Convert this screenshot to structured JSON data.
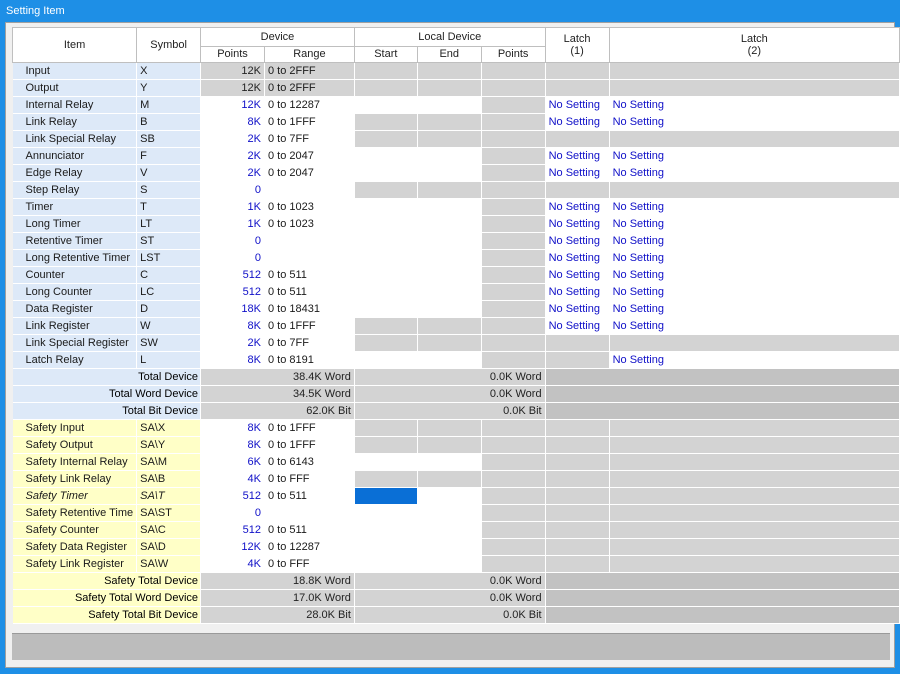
{
  "window": {
    "title": "Setting Item"
  },
  "headers": {
    "item": "Item",
    "symbol": "Symbol",
    "device": "Device",
    "local_device": "Local Device",
    "points": "Points",
    "range": "Range",
    "start": "Start",
    "end": "End",
    "local_points": "Points",
    "latch1": "Latch\n(1)",
    "latch2": "Latch\n(2)"
  },
  "devices": [
    {
      "name": "Input",
      "symbol": "X",
      "points": "12K",
      "range": "0 to 2FFF",
      "latch1": "",
      "latch2": ""
    },
    {
      "name": "Output",
      "symbol": "Y",
      "points": "12K",
      "range": "0 to 2FFF",
      "latch1": "",
      "latch2": ""
    },
    {
      "name": "Internal Relay",
      "symbol": "M",
      "points": "12K",
      "range": "0 to 12287",
      "latch1": "No Setting",
      "latch2": "No Setting"
    },
    {
      "name": "Link Relay",
      "symbol": "B",
      "points": "8K",
      "range": "0 to 1FFF",
      "latch1": "No Setting",
      "latch2": "No Setting"
    },
    {
      "name": "Link Special Relay",
      "symbol": "SB",
      "points": "2K",
      "range": "0 to 7FF",
      "latch1": "",
      "latch2": ""
    },
    {
      "name": "Annunciator",
      "symbol": "F",
      "points": "2K",
      "range": "0 to 2047",
      "latch1": "No Setting",
      "latch2": "No Setting"
    },
    {
      "name": "Edge Relay",
      "symbol": "V",
      "points": "2K",
      "range": "0 to 2047",
      "latch1": "No Setting",
      "latch2": "No Setting"
    },
    {
      "name": "Step Relay",
      "symbol": "S",
      "points": "0",
      "range": "",
      "latch1": "",
      "latch2": ""
    },
    {
      "name": "Timer",
      "symbol": "T",
      "points": "1K",
      "range": "0 to 1023",
      "latch1": "No Setting",
      "latch2": "No Setting"
    },
    {
      "name": "Long Timer",
      "symbol": "LT",
      "points": "1K",
      "range": "0 to 1023",
      "latch1": "No Setting",
      "latch2": "No Setting"
    },
    {
      "name": "Retentive Timer",
      "symbol": "ST",
      "points": "0",
      "range": "",
      "latch1": "No Setting",
      "latch2": "No Setting"
    },
    {
      "name": "Long Retentive Timer",
      "symbol": "LST",
      "points": "0",
      "range": "",
      "latch1": "No Setting",
      "latch2": "No Setting"
    },
    {
      "name": "Counter",
      "symbol": "C",
      "points": "512",
      "range": "0 to 511",
      "latch1": "No Setting",
      "latch2": "No Setting"
    },
    {
      "name": "Long Counter",
      "symbol": "LC",
      "points": "512",
      "range": "0 to 511",
      "latch1": "No Setting",
      "latch2": "No Setting"
    },
    {
      "name": "Data Register",
      "symbol": "D",
      "points": "18K",
      "range": "0 to 18431",
      "latch1": "No Setting",
      "latch2": "No Setting"
    },
    {
      "name": "Link Register",
      "symbol": "W",
      "points": "8K",
      "range": "0 to 1FFF",
      "latch1": "No Setting",
      "latch2": "No Setting"
    },
    {
      "name": "Link Special Register",
      "symbol": "SW",
      "points": "2K",
      "range": "0 to 7FF",
      "latch1": "",
      "latch2": ""
    },
    {
      "name": "Latch Relay",
      "symbol": "L",
      "points": "8K",
      "range": "0 to 8191",
      "latch1": "",
      "latch2": "No Setting"
    }
  ],
  "totals": [
    {
      "label": "Total Device",
      "device": "38.4K Word",
      "local": "0.0K Word"
    },
    {
      "label": "Total Word Device",
      "device": "34.5K Word",
      "local": "0.0K Word"
    },
    {
      "label": "Total Bit Device",
      "device": "62.0K Bit",
      "local": "0.0K Bit"
    }
  ],
  "safety": [
    {
      "name": "Safety Input",
      "symbol": "SA\\X",
      "points": "8K",
      "range": "0 to 1FFF"
    },
    {
      "name": "Safety Output",
      "symbol": "SA\\Y",
      "points": "8K",
      "range": "0 to 1FFF"
    },
    {
      "name": "Safety Internal Relay",
      "symbol": "SA\\M",
      "points": "6K",
      "range": "0 to 6143"
    },
    {
      "name": "Safety Link Relay",
      "symbol": "SA\\B",
      "points": "4K",
      "range": "0 to FFF"
    },
    {
      "name": "Safety Timer",
      "symbol": "SA\\T",
      "points": "512",
      "range": "0 to 511"
    },
    {
      "name": "Safety Retentive Time",
      "symbol": "SA\\ST",
      "points": "0",
      "range": ""
    },
    {
      "name": "Safety Counter",
      "symbol": "SA\\C",
      "points": "512",
      "range": "0 to 511"
    },
    {
      "name": "Safety Data Register",
      "symbol": "SA\\D",
      "points": "12K",
      "range": "0 to 12287"
    },
    {
      "name": "Safety Link Register",
      "symbol": "SA\\W",
      "points": "4K",
      "range": "0 to FFF"
    }
  ],
  "safety_totals": [
    {
      "label": "Safety Total Device",
      "device": "18.8K Word",
      "local": "0.0K Word"
    },
    {
      "label": "Safety Total Word Device",
      "device": "17.0K Word",
      "local": "0.0K Word"
    },
    {
      "label": "Safety Total Bit Device",
      "device": "28.0K Bit",
      "local": "0.0K Bit"
    }
  ]
}
